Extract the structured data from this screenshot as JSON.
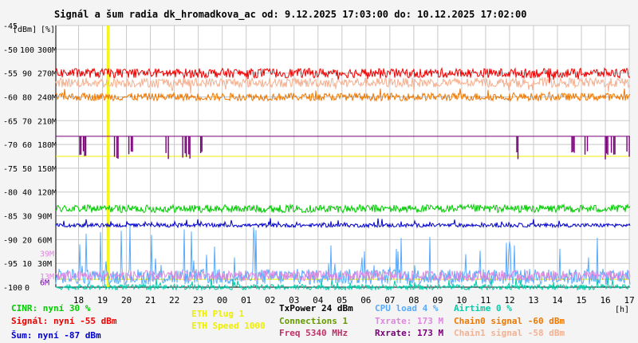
{
  "chart_data": {
    "type": "line",
    "title": "Signál a šum radia dk_hromadkova_ac od: 9.12.2025 17:03:00 do: 10.12.2025 17:02:00",
    "y_unit_label": "[dBm]",
    "y2_unit_label": "[%]",
    "x_unit_label": "[h]",
    "dbm_axis": {
      "ylim": [
        -100,
        -45
      ],
      "ticks": [
        -100,
        -95,
        -90,
        -85,
        -80,
        -75,
        -70,
        -65,
        -60,
        -55,
        -50,
        -45
      ]
    },
    "percent_axis": {
      "ylim": [
        0,
        100
      ],
      "ticks": [
        0,
        10,
        20,
        30,
        40,
        50,
        60,
        70,
        80,
        90,
        100
      ]
    },
    "rate_axis": {
      "ylim": [
        0,
        300
      ],
      "ticks": [
        "",
        "30M",
        "60M",
        "90M",
        "120M",
        "150M",
        "180M",
        "210M",
        "240M",
        "270M",
        "300M"
      ]
    },
    "inner_labels": [
      {
        "text": "39M",
        "value": 39,
        "color": "#dd88dd"
      },
      {
        "text": "13M",
        "value": 13,
        "color": "#dd88dd"
      },
      {
        "text": "6M",
        "value": 6,
        "color": "#7700aa"
      }
    ],
    "x_ticks": [
      "18",
      "19",
      "20",
      "21",
      "22",
      "23",
      "00",
      "01",
      "02",
      "03",
      "04",
      "05",
      "06",
      "07",
      "08",
      "09",
      "10",
      "11",
      "12",
      "13",
      "14",
      "15",
      "16",
      "17"
    ],
    "x_start_hour": 17.05,
    "x_end_hour": 41.03,
    "markers": [
      {
        "hour": 19.2,
        "color": "#eeee00"
      }
    ],
    "series": [
      {
        "name": "Signál",
        "axis": "dbm",
        "base": -55,
        "spread": 1.0,
        "color": "#ee0000"
      },
      {
        "name": "Chain1 signal",
        "axis": "dbm",
        "base": -57,
        "spread": 1.0,
        "color": "#f4b090"
      },
      {
        "name": "Chain0 signal",
        "axis": "dbm",
        "base": -60,
        "spread": 0.8,
        "color": "#ee7700"
      },
      {
        "name": "Rxrate",
        "axis": "rate",
        "base": 173,
        "dips": 146,
        "color": "#770077"
      },
      {
        "name": "CINR",
        "axis": "percent",
        "base": 30,
        "spread": 1.5,
        "color": "#00cc00"
      },
      {
        "name": "Šum",
        "axis": "dbm",
        "base": -87,
        "spread": 0.4,
        "color": "#0000cc"
      },
      {
        "name": "CPU load",
        "axis": "percent",
        "base": 4,
        "spread": 3,
        "color": "#55aaff"
      },
      {
        "name": "Txrate",
        "axis": "rate",
        "base": 13,
        "spread": 6,
        "color": "#dd88dd"
      },
      {
        "name": "Airtime",
        "axis": "percent",
        "base": 0,
        "spread": 1,
        "color": "#00ccaa"
      },
      {
        "name": "ETH Speed",
        "axis": "percent",
        "base": 50,
        "color": "#eeee00"
      },
      {
        "name": "ETH Plug",
        "axis": "percent",
        "base": 3,
        "color": "#eeee00"
      }
    ]
  },
  "legend": {
    "cinr": "CINR: nyní 30 %",
    "signal": "Signál: nyní -55 dBm",
    "noise": "Šum: nyní -87 dBm",
    "eth_plug": "ETH Plug 1",
    "eth_speed": "ETH Speed 1000",
    "txpower": "TxPower 24 dBm",
    "connections": "Connections 1",
    "freq": "Freq 5340 MHz",
    "cpu": "CPU load 4 %",
    "txrate": "Txrate: 173 M",
    "rxrate": "Rxrate: 173 M",
    "airtime": "Airtime 0 %",
    "chain0": "Chain0 signal -60 dBm",
    "chain1": "Chain1 signal -58 dBm"
  },
  "colors": {
    "background": "#f4f4f4",
    "plot_bg": "#ffffff",
    "grid": "#c8c8c8",
    "cinr": "#00cc00",
    "signal": "#ee0000",
    "noise": "#0000cc",
    "eth": "#eeee00",
    "txpower": "#000000",
    "connections": "#669900",
    "freq": "#bb3366",
    "cpu": "#55aaff",
    "txrate": "#dd88dd",
    "rxrate": "#770077",
    "airtime": "#00ccaa",
    "chain0": "#ee7700",
    "chain1": "#f4b090"
  }
}
